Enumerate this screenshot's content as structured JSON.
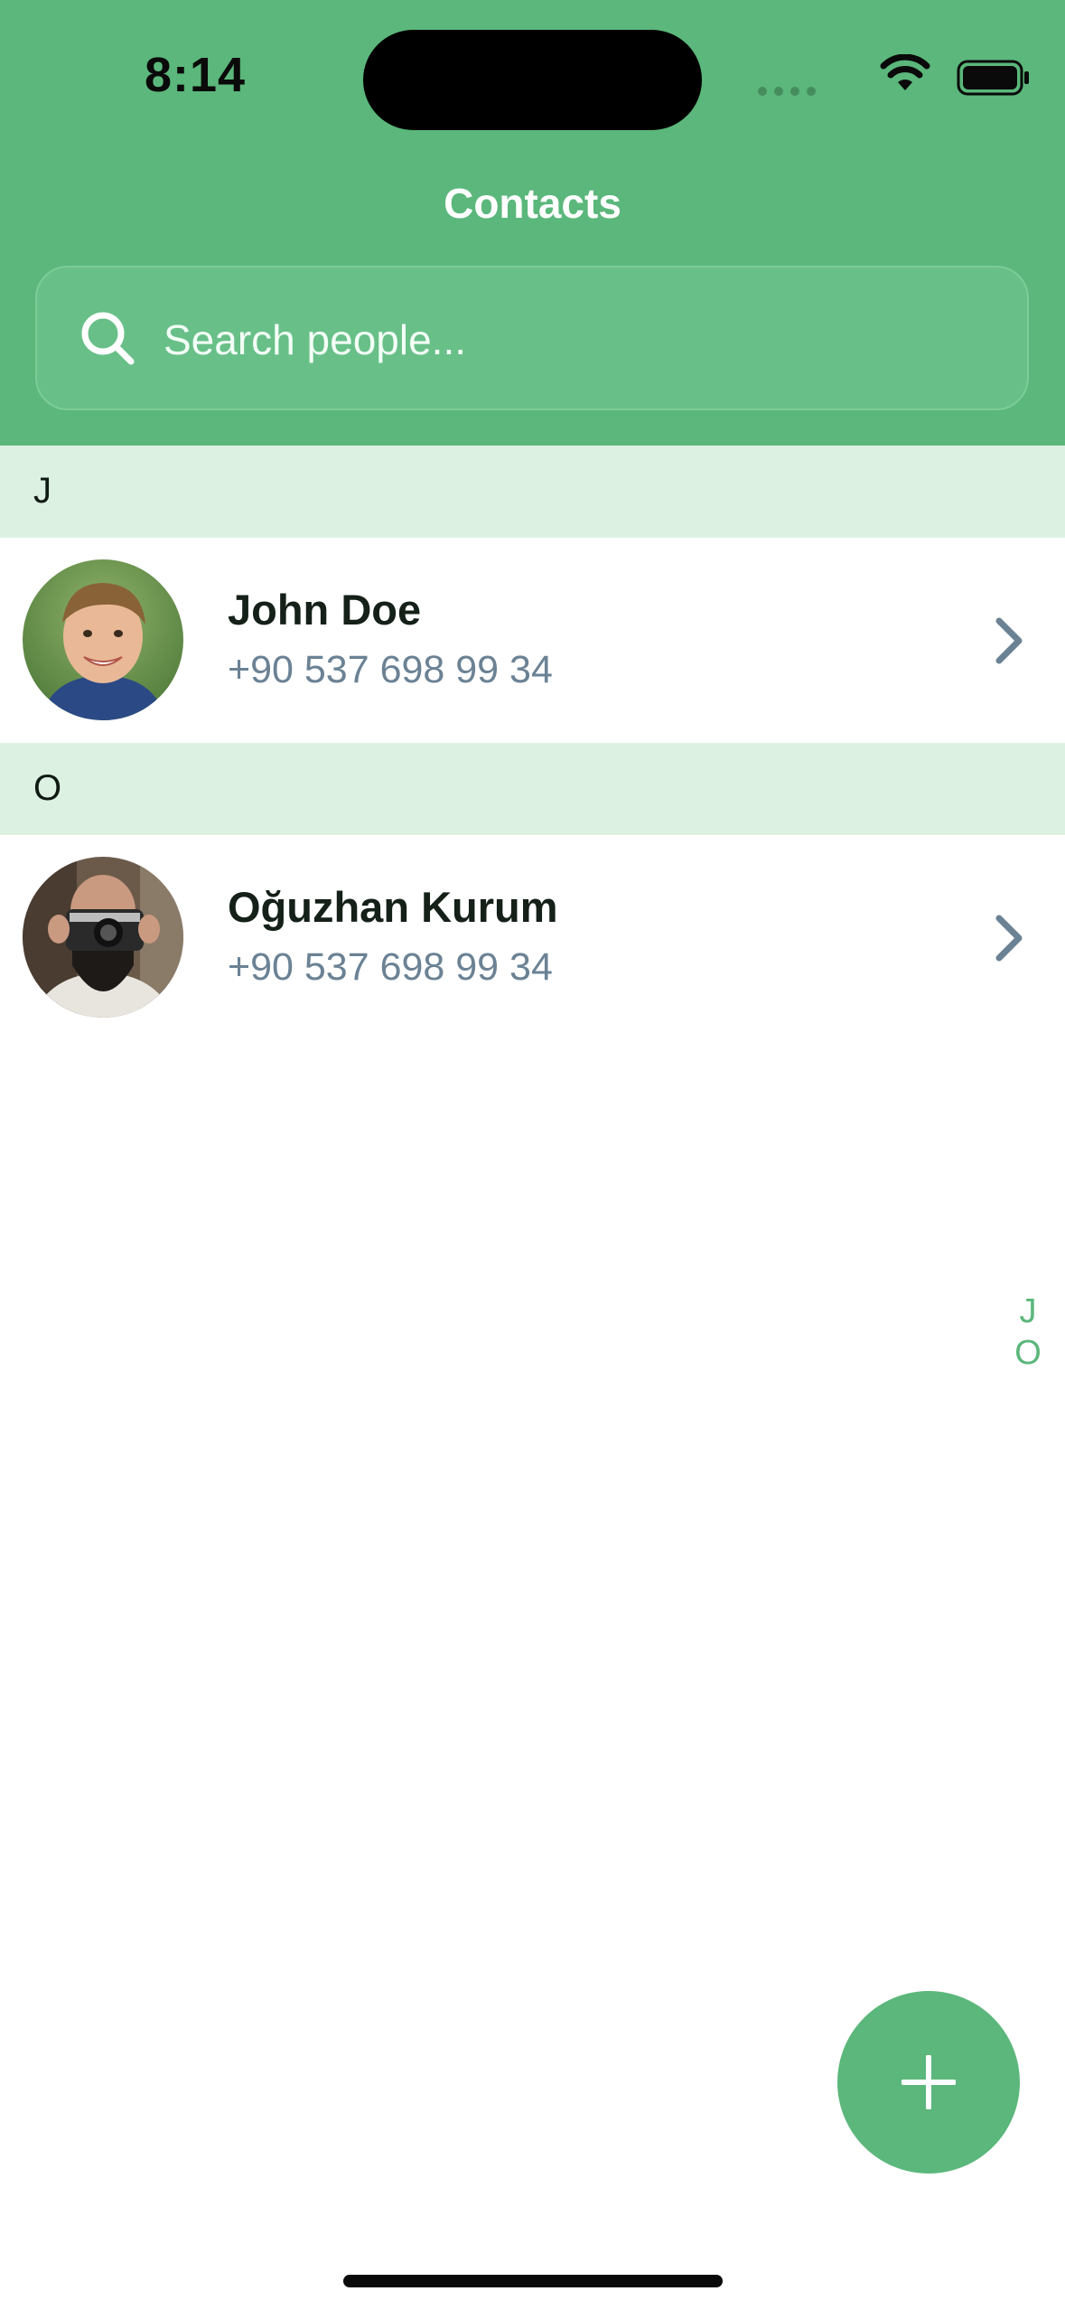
{
  "status_bar": {
    "time": "8:14"
  },
  "header": {
    "title": "Contacts",
    "search": {
      "placeholder": "Search people...",
      "value": ""
    }
  },
  "sections": [
    {
      "letter": "J",
      "contacts": [
        {
          "name": "John Doe",
          "phone": "+90 537 698 99 34",
          "avatar": "boy-portrait"
        }
      ]
    },
    {
      "letter": "O",
      "contacts": [
        {
          "name": "Oğuzhan Kurum",
          "phone": "+90 537 698 99 34",
          "avatar": "man-with-camera"
        }
      ]
    }
  ],
  "index_letters": [
    "J",
    "O"
  ],
  "fab": {
    "icon": "plus-icon"
  },
  "colors": {
    "accent": "#5bb77b",
    "section_bg": "#ddf1e3",
    "phone_text": "#6b8294"
  }
}
